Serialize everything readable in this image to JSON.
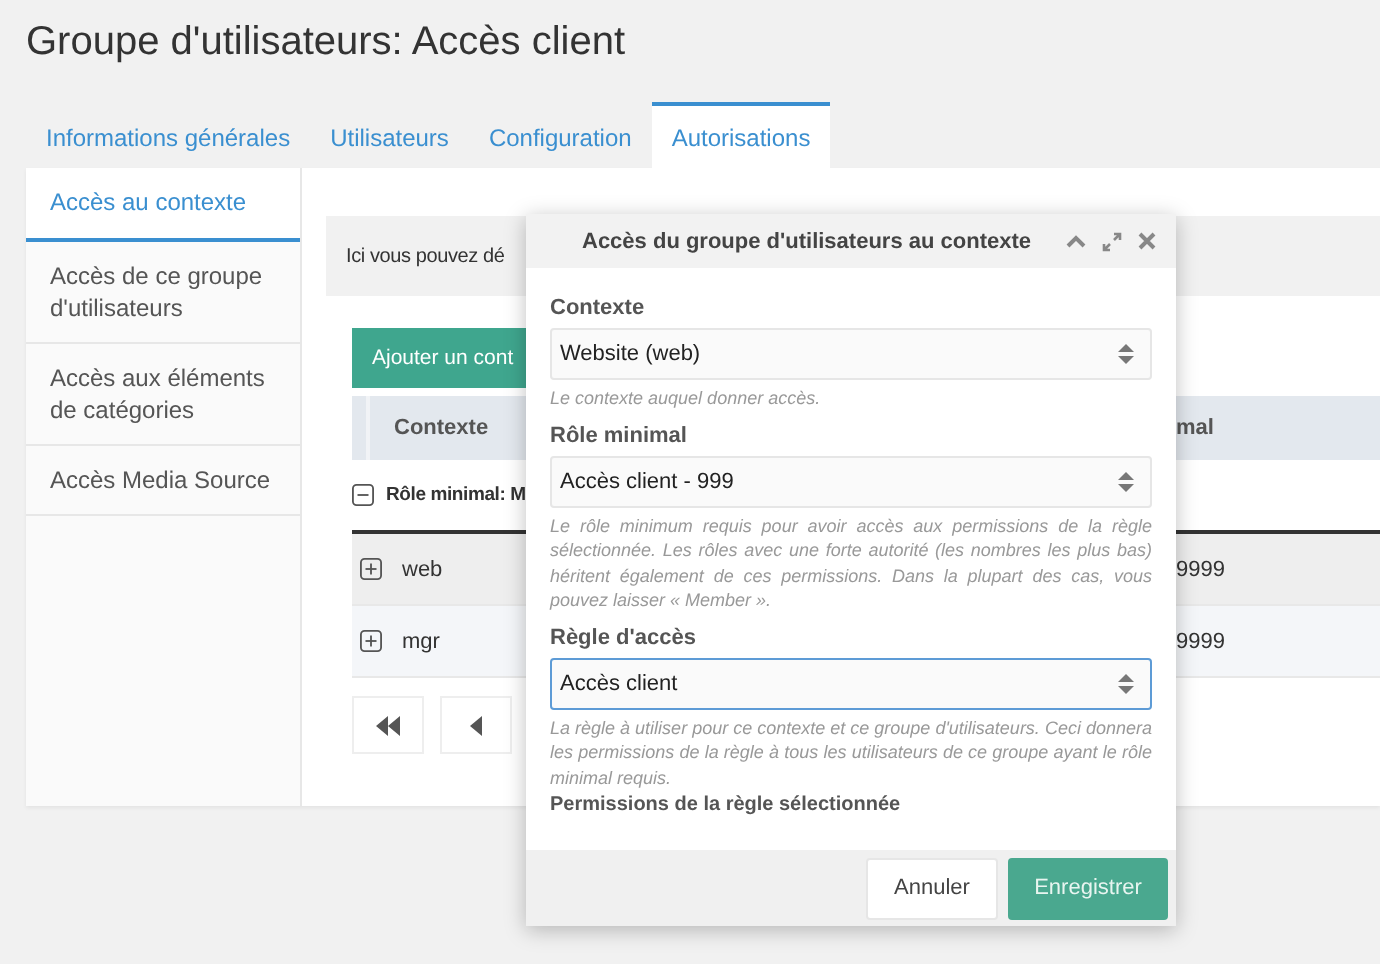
{
  "page_title": "Groupe d'utilisateurs: Accès client",
  "tabs": [
    {
      "label": "Informations générales",
      "selected": false
    },
    {
      "label": "Utilisateurs",
      "selected": false
    },
    {
      "label": "Configuration",
      "selected": false
    },
    {
      "label": "Autorisations",
      "selected": true
    }
  ],
  "side_tabs": [
    {
      "label": "Accès au contexte",
      "selected": true
    },
    {
      "label": "Accès de ce groupe d'utilisateurs",
      "selected": false
    },
    {
      "label": "Accès aux éléments de catégories",
      "selected": false
    },
    {
      "label": "Accès Media Source",
      "selected": false
    }
  ],
  "info_text": "Ici vous pouvez dé",
  "add_button": "Ajouter un cont",
  "table": {
    "columns": [
      "Contexte",
      "mal"
    ],
    "group": {
      "label": "Rôle minimal: M",
      "expanded": true
    },
    "rows": [
      {
        "context": "web",
        "expanded": false,
        "column_2": "9999"
      },
      {
        "context": "mgr",
        "expanded": false,
        "column_2": "9999"
      }
    ]
  },
  "dialog": {
    "title": "Accès du groupe d'utilisateurs au contexte",
    "fields": [
      {
        "label": "Contexte",
        "value": "Website (web)",
        "help": "Le contexte auquel donner accès.",
        "focused": false
      },
      {
        "label": "Rôle minimal",
        "value": "Accès client - 999",
        "help": "Le rôle minimum requis pour avoir accès aux permissions de la règle sélectionnée. Les rôles avec une forte autorité (les nombres les plus bas) héritent également de ces permissions. Dans la plupart des cas, vous pouvez laisser « Member ».",
        "focused": false
      },
      {
        "label": "Règle d'accès",
        "value": "Accès client",
        "help": "La règle à utiliser pour ce contexte et ce groupe d'utilisateurs. Ceci donnera les permissions de la règle à tous les utilisateurs de ce groupe ayant le rôle minimal requis.",
        "focused": true
      }
    ],
    "section_heading": "Permissions de la règle sélectionnée",
    "buttons": [
      {
        "label": "Annuler",
        "kind": "secondary"
      },
      {
        "label": "Enregistrer",
        "kind": "primary"
      }
    ]
  }
}
